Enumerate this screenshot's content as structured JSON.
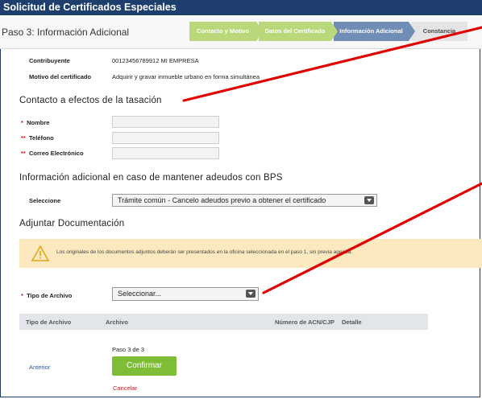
{
  "window": {
    "title": "Solicitud de Certificados Especiales"
  },
  "stepbar": {
    "title": "Paso 3: Información Adicional",
    "steps": [
      {
        "label": "Contacto y Motivo",
        "state": "done"
      },
      {
        "label": "Datos del Certificado",
        "state": "done"
      },
      {
        "label": "Información Adicional",
        "state": "active"
      },
      {
        "label": "Constancia",
        "state": "pending"
      }
    ]
  },
  "summary": {
    "contribuyente_label": "Contribuyente",
    "contribuyente_value": "00123456789912   MI EMPRESA",
    "motivo_label": "Motivo del certificado",
    "motivo_value": "Adquirir y gravar inmueble urbano en forma simultánea"
  },
  "contact": {
    "heading": "Contacto a efectos de la tasación",
    "nombre_label": "Nombre",
    "nombre_value": "",
    "telefono_label": "Teléfono",
    "telefono_value": "",
    "correo_label": "Correo Electrónico",
    "correo_value": ""
  },
  "adeudos": {
    "heading": "Información adicional en caso de mantener adeudos con BPS",
    "select_label": "Seleccione",
    "select_value": "Trámite común - Cancelo adeudos previo a obtener el certificado"
  },
  "docs": {
    "heading": "Adjuntar Documentación",
    "warning": "Los originales de los documentos adjuntos deberán ser presentados en la oficina seleccionada en el paso 1, sin previa agenda.",
    "tipo_label": "Tipo de Archivo",
    "tipo_value": "Seleccionar...",
    "table_headers": [
      "Tipo de Archivo",
      "Archivo",
      "Número de ACN/CJP",
      "Detalle"
    ]
  },
  "footer": {
    "prev_link": "Anterior",
    "paso": "Paso 3 de 3",
    "confirm": "Confirmar",
    "cancel": "Cancelar"
  },
  "colors": {
    "titlebar": "#1e3f6e",
    "step_done": "#b9d87a",
    "step_active": "#6f8db5",
    "confirm": "#7fbd37",
    "required": "#c0262d",
    "annotation_line": "#e00000"
  }
}
